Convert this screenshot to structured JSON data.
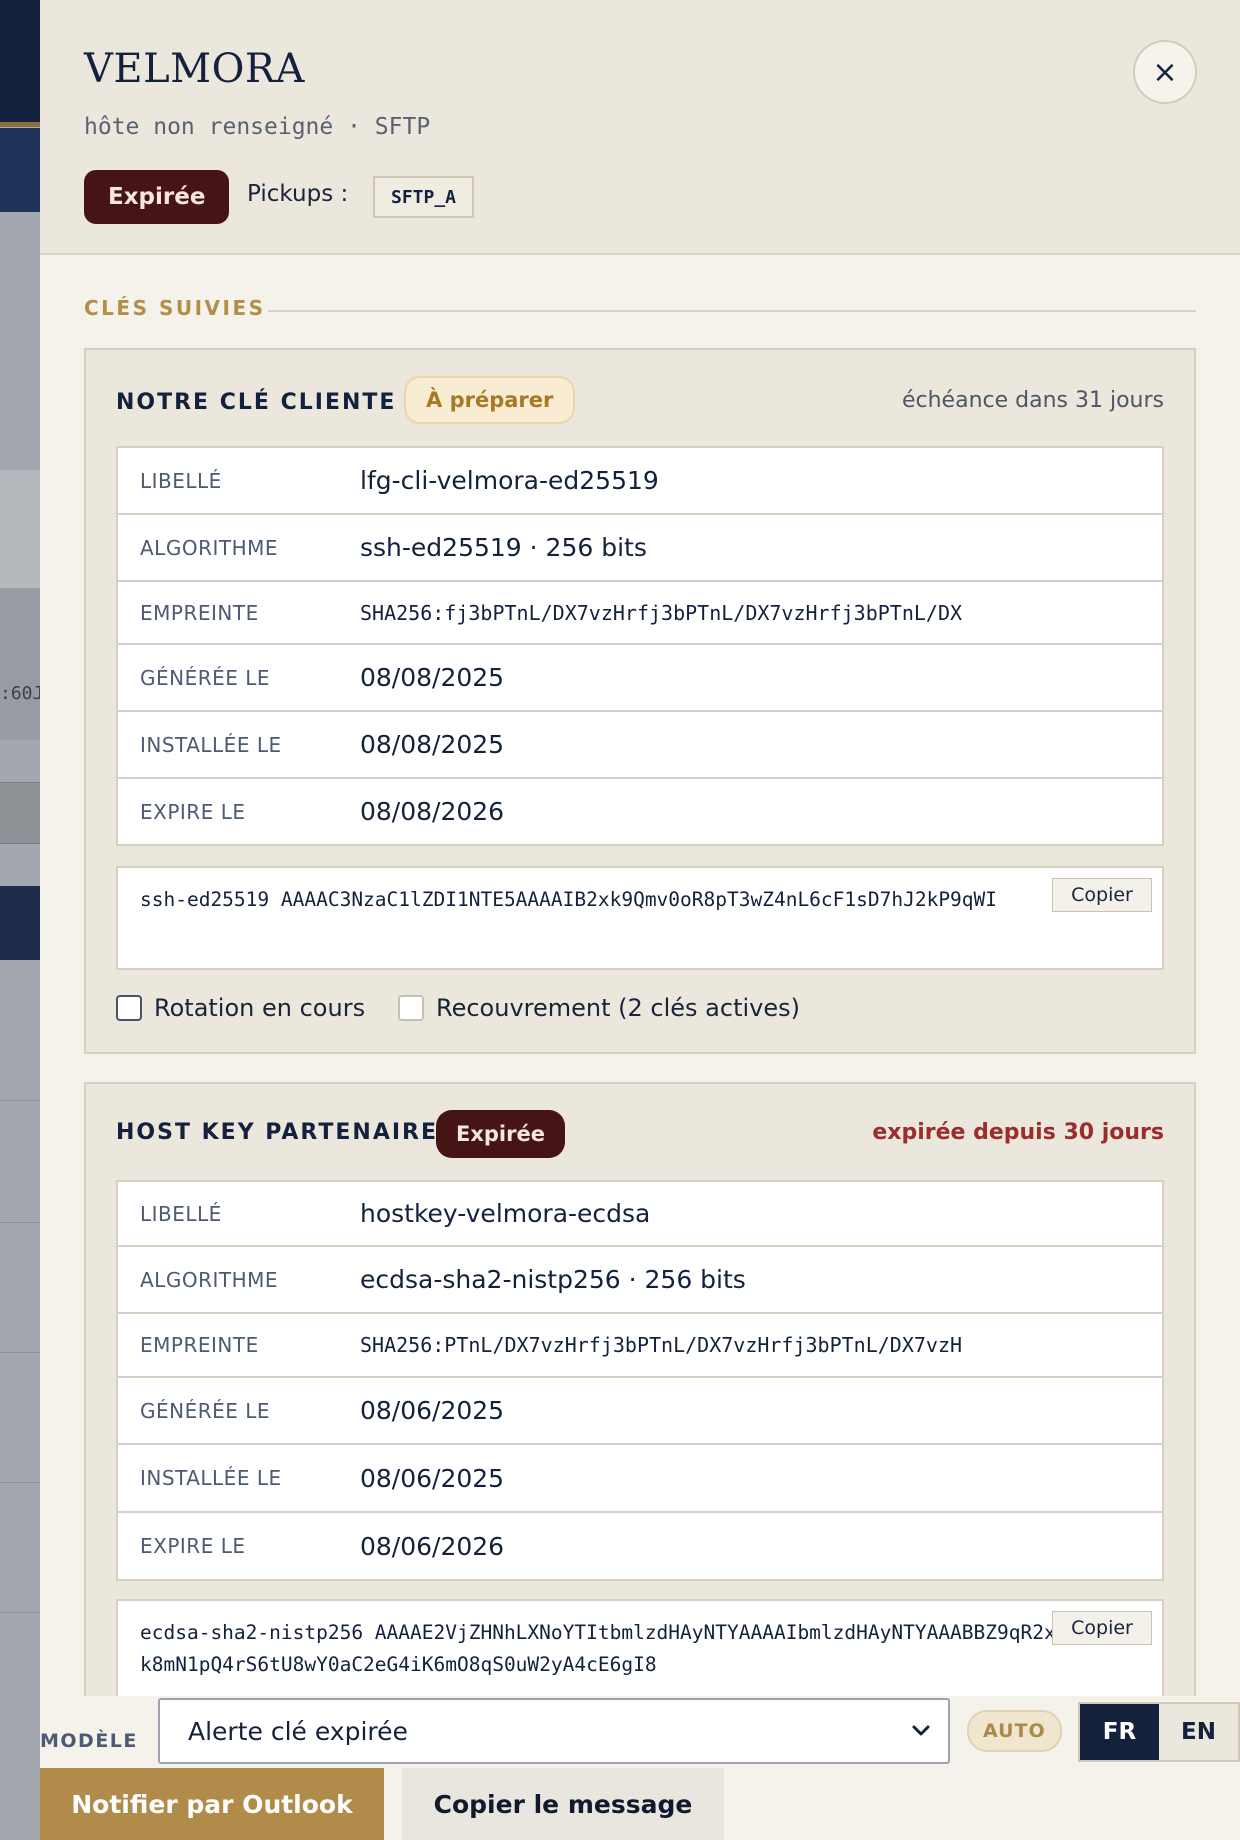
{
  "background": {
    "fragment_text": ":60J"
  },
  "header": {
    "title": "VELMORA",
    "subtitle": "hôte non renseigné · SFTP",
    "close_symbol": "×",
    "status": "Expirée",
    "pickups_label": "Pickups :",
    "pickups": [
      "SFTP_A"
    ]
  },
  "section": {
    "title": "CLÉS SUIVIES"
  },
  "client_key": {
    "title": "NOTRE CLÉ CLIENTE",
    "badge": "À préparer",
    "deadline": "échéance dans 31 jours",
    "rows": [
      {
        "key": "LIBELLÉ",
        "value": "lfg-cli-velmora-ed25519"
      },
      {
        "key": "ALGORITHME",
        "value": "ssh-ed25519 · 256 bits"
      },
      {
        "key": "EMPREINTE",
        "value": "SHA256:fj3bPTnL/DX7vzHrfj3bPTnL/DX7vzHrfj3bPTnL/DX"
      },
      {
        "key": "GÉNÉRÉE LE",
        "value": "08/08/2025"
      },
      {
        "key": "INSTALLÉE LE",
        "value": "08/08/2025"
      },
      {
        "key": "EXPIRE LE",
        "value": "08/08/2026"
      }
    ],
    "public_key": "ssh-ed25519 AAAAC3NzaC1lZDI1NTE5AAAAIB2xk9Qmv0oR8pT3wZ4nL6cF1sD7hJ2kP9qWI",
    "copy_label": "Copier",
    "checkbox_rotation": "Rotation en cours",
    "checkbox_overlap": "Recouvrement (2 clés actives)"
  },
  "host_key": {
    "title": "HOST KEY PARTENAIRE",
    "badge": "Expirée",
    "deadline": "expirée depuis 30 jours",
    "rows": [
      {
        "key": "LIBELLÉ",
        "value": "hostkey-velmora-ecdsa"
      },
      {
        "key": "ALGORITHME",
        "value": "ecdsa-sha2-nistp256 · 256 bits"
      },
      {
        "key": "EMPREINTE",
        "value": "SHA256:PTnL/DX7vzHrfj3bPTnL/DX7vzHrfj3bPTnL/DX7vzH"
      },
      {
        "key": "GÉNÉRÉE LE",
        "value": "08/06/2025"
      },
      {
        "key": "INSTALLÉE LE",
        "value": "08/06/2025"
      },
      {
        "key": "EXPIRE LE",
        "value": "08/06/2026"
      }
    ],
    "public_key": "ecdsa-sha2-nistp256 AAAAE2VjZHNhLXNoYTItbmlzdHAyNTYAAAAIbmlzdHAyNTYAAABBZ9qR2xk8mN1pQ4rS6tU8wY0aC2eG4iK6mO8qS0uW2yA4cE6gI8",
    "copy_label": "Copier"
  },
  "footer": {
    "model_label": "MODÈLE",
    "model_value": "Alerte clé expirée",
    "auto_label": "AUTO",
    "lang_fr": "FR",
    "lang_en": "EN",
    "notify_button": "Notifier par Outlook",
    "copy_message_button": "Copier le message"
  },
  "colors": {
    "navy": "#14213d",
    "gold": "#b08b4a",
    "expired": "#461416",
    "alert_text": "#9b2d2d"
  }
}
